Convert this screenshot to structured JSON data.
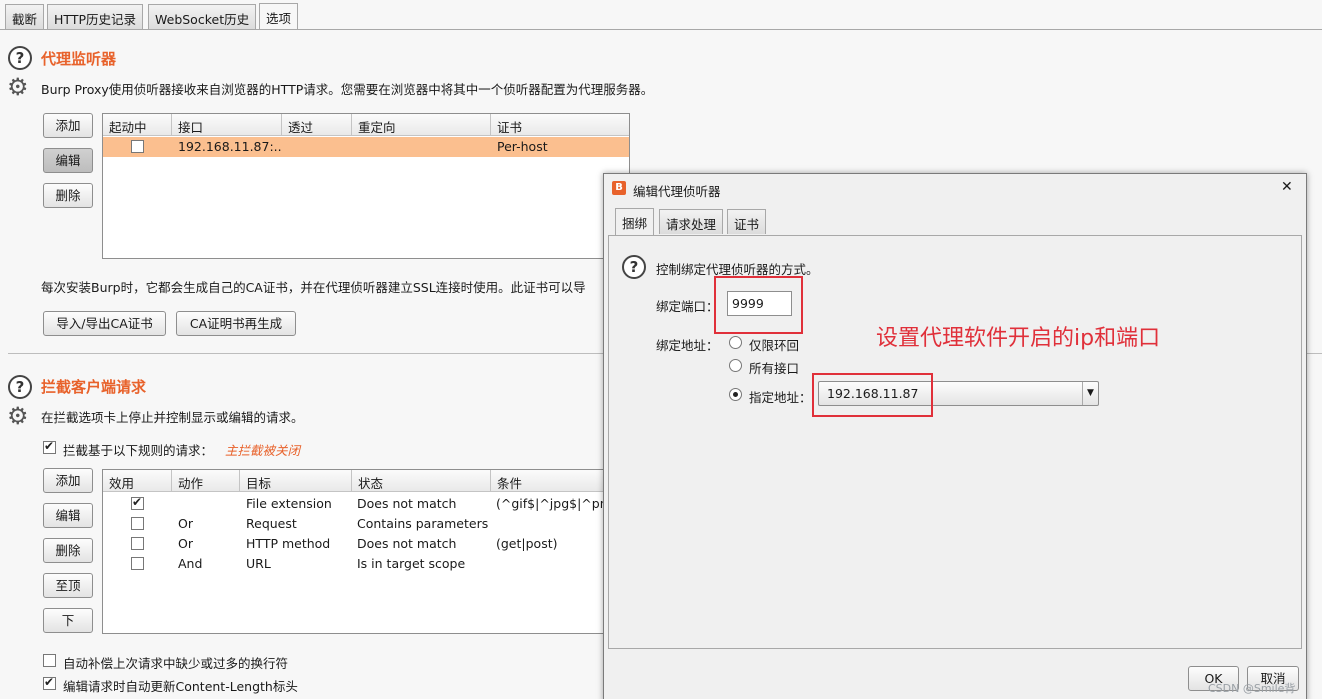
{
  "tabs": [
    "截断",
    "HTTP历史记录",
    "WebSocket历史",
    "选项"
  ],
  "listeners": {
    "heading": "代理监听器",
    "description": "Burp Proxy使用侦听器接收来自浏览器的HTTP请求。您需要在浏览器中将其中一个侦听器配置为代理服务器。",
    "buttons": {
      "add": "添加",
      "edit": "编辑",
      "delete": "删除"
    },
    "columns": [
      "起动中",
      "接口",
      "透过",
      "重定向",
      "证书"
    ],
    "rows": [
      {
        "running": false,
        "interface": "192.168.11.87:...",
        "invisible": "",
        "redirect": "",
        "certificate": "Per-host"
      }
    ],
    "ca_text": "每次安装Burp时，它都会生成自己的CA证书，并在代理侦听器建立SSL连接时使用。此证书可以导",
    "import_export_button": "导入/导出CA证书",
    "regen_button": "CA证明书再生成"
  },
  "intercept": {
    "heading": "拦截客户端请求",
    "description": "在拦截选项卡上停止并控制显示或编辑的请求。",
    "rule_checkbox_label": "拦截基于以下规则的请求：",
    "rule_checkbox_checked": true,
    "master_off_note": "主拦截被关闭",
    "buttons": {
      "add": "添加",
      "edit": "编辑",
      "delete": "删除",
      "top": "至顶",
      "down": "下"
    },
    "columns": [
      "效用",
      "动作",
      "目标",
      "状态",
      "条件"
    ],
    "rows": [
      {
        "enabled": true,
        "operator": "",
        "target": "File extension",
        "relationship": "Does not match",
        "condition": "(^gif$|^jpg$|^png$|^c"
      },
      {
        "enabled": false,
        "operator": "Or",
        "target": "Request",
        "relationship": "Contains parameters",
        "condition": ""
      },
      {
        "enabled": false,
        "operator": "Or",
        "target": "HTTP method",
        "relationship": "Does not match",
        "condition": "(get|post)"
      },
      {
        "enabled": false,
        "operator": "And",
        "target": "URL",
        "relationship": "Is in target scope",
        "condition": ""
      }
    ],
    "auto_fix_label": "自动补偿上次请求中缺少或过多的换行符",
    "auto_fix_checked": false,
    "update_length_label": "编辑请求时自动更新Content-Length标头",
    "update_length_checked": true
  },
  "dialog": {
    "title": "编辑代理侦听器",
    "close_glyph": "✕",
    "tabs": [
      "捆绑",
      "请求处理",
      "证书"
    ],
    "description": "控制绑定代理侦听器的方式。",
    "port_label": "绑定端口：",
    "port_value": "9999",
    "address_label": "绑定地址：",
    "address_options": [
      "仅限环回",
      "所有接口",
      "指定地址："
    ],
    "selected_address_index": 2,
    "specific_address_value": "192.168.11.87",
    "annotation": "设置代理软件开启的ip和端口",
    "ok": "OK",
    "cancel": "取消"
  },
  "watermark": "CSDN @Smile背",
  "colors": {
    "accent": "#e8622b",
    "selected_row": "#fbbf8f",
    "annotation": "#e0303a"
  }
}
